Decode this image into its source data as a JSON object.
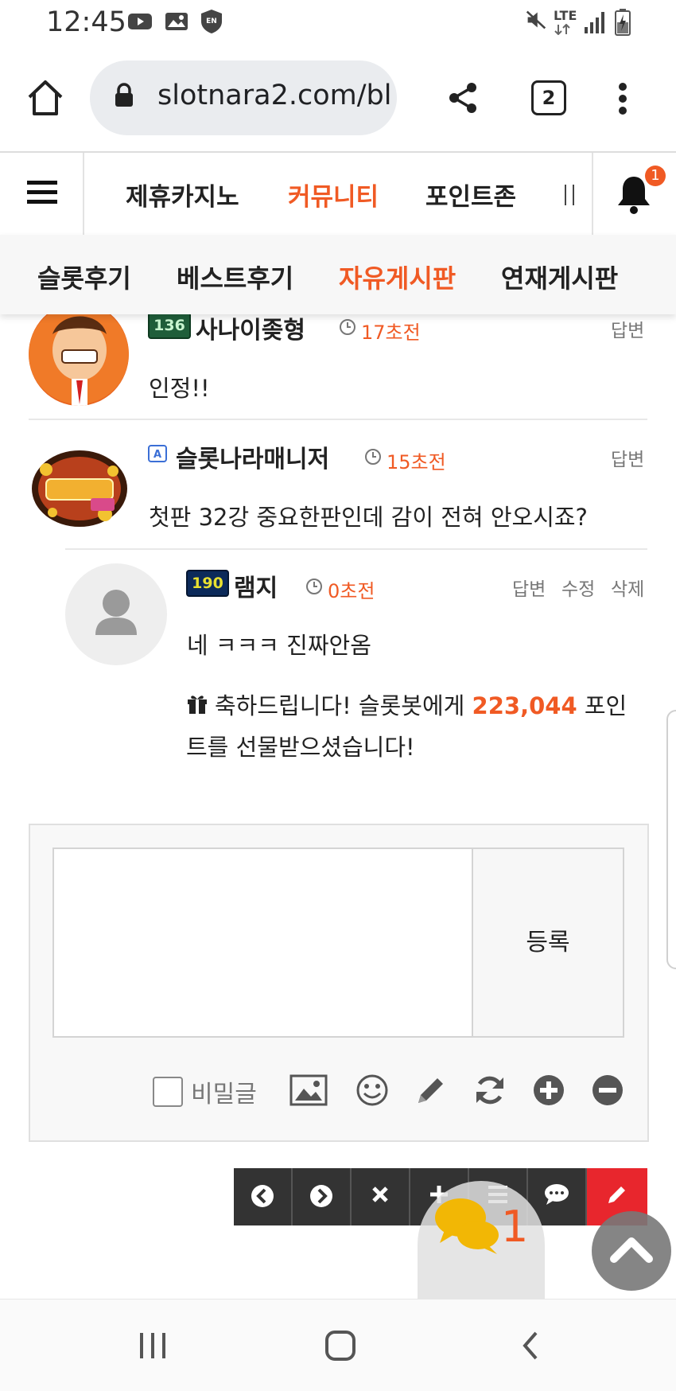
{
  "status_bar": {
    "time": "12:45",
    "network": "LTE"
  },
  "browser": {
    "url": "slotnara2.com/bl",
    "tab_count": "2"
  },
  "site_nav": {
    "items": [
      "제휴카지노",
      "커뮤니티",
      "포인트존"
    ],
    "active": "커뮤니티",
    "notification_count": "1"
  },
  "sub_nav": {
    "items": [
      "슬롯후기",
      "베스트후기",
      "자유게시판",
      "연재게시판"
    ],
    "active": "자유게시판"
  },
  "comments": [
    {
      "level": "136",
      "name": "사나이좆형",
      "time": "17초전",
      "actions": [
        "답변"
      ],
      "text": "인정!!"
    },
    {
      "level": "",
      "name": "슬롯나라매니저",
      "time": "15초전",
      "actions": [
        "답변"
      ],
      "text": "첫판 32강 중요한판인데 감이 전혀 안오시죠?"
    },
    {
      "level": "190",
      "name": "램지",
      "time": "0초전",
      "actions": [
        "답변",
        "수정",
        "삭제"
      ],
      "text": "네 ㅋㅋㅋ 진짜안옴",
      "gift_line1_pre": "축하드립니다! 슬롯봇에게 ",
      "gift_points": "223,044",
      "gift_line1_post": " 포인",
      "gift_line2": "트를 선물받으셨습니다!"
    }
  ],
  "comment_form": {
    "submit_label": "등록",
    "secret_label": "비밀글",
    "secret_checked": false
  },
  "float_bar": {
    "chat_count": "1"
  },
  "colors": {
    "accent": "#f05a24",
    "danger": "#e8262d",
    "toolbar": "#333333"
  }
}
